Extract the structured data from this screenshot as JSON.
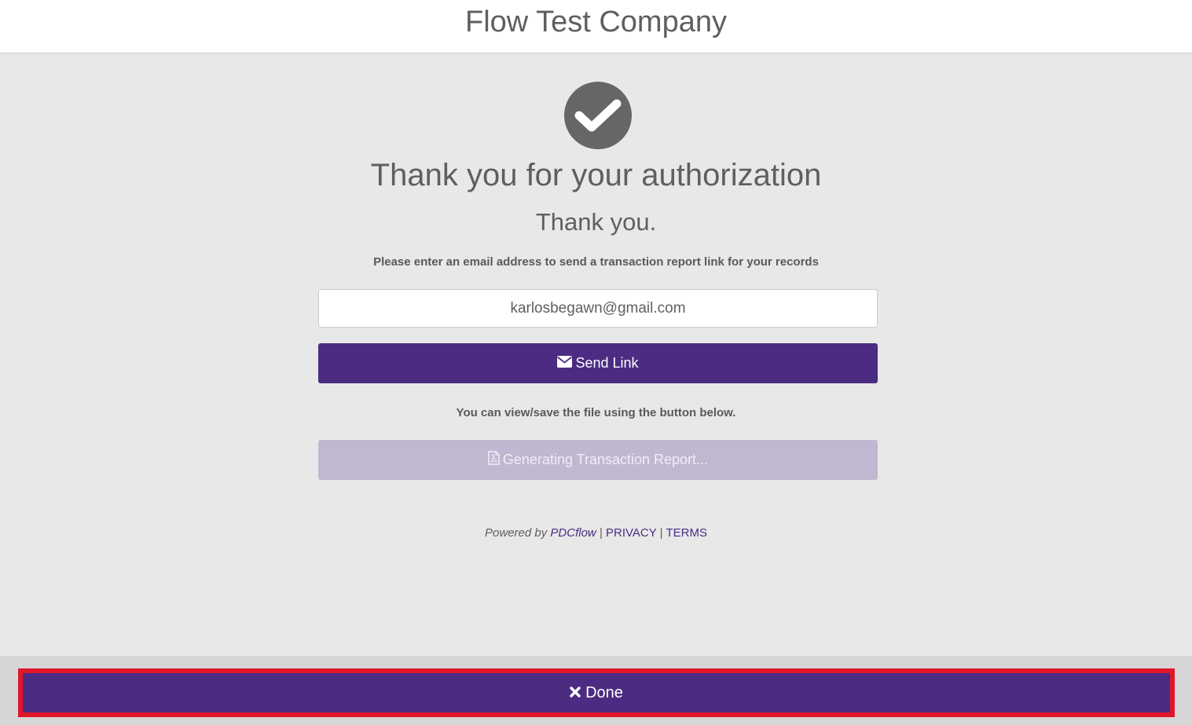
{
  "header": {
    "company_name": "Flow Test Company"
  },
  "main": {
    "title": "Thank you for your authorization",
    "subtitle": "Thank you.",
    "instructions": "Please enter an email address to send a transaction report link for your records",
    "email_value": "karlosbegawn@gmail.com",
    "send_link_label": "Send Link",
    "view_text": "You can view/save the file using the button below.",
    "report_button_label": "Generating Transaction Report..."
  },
  "footer": {
    "powered_by": "Powered by",
    "brand": "PDCflow",
    "separator": "|",
    "privacy": "PRIVACY",
    "terms": "TERMS"
  },
  "bottom": {
    "done_label": "Done"
  },
  "colors": {
    "accent": "#4b2c82",
    "disabled_button": "#c0b8d1",
    "highlight_border": "#e0162b",
    "check_circle": "#666666"
  },
  "icons": {
    "check": "check-icon",
    "envelope": "envelope-icon",
    "pdf": "file-pdf-icon",
    "close": "close-icon"
  }
}
